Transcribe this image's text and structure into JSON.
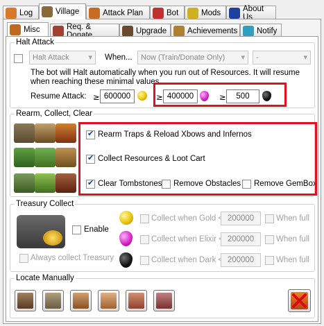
{
  "tabs_top": [
    {
      "label": "Log",
      "icon": "log-icon",
      "color": "#d97a2a"
    },
    {
      "label": "Village",
      "icon": "village-icon",
      "color": "#8a6a3a"
    },
    {
      "label": "Attack Plan",
      "icon": "attack-plan-icon",
      "color": "#c86a20"
    },
    {
      "label": "Bot",
      "icon": "bot-icon",
      "color": "#c03030"
    },
    {
      "label": "Mods",
      "icon": "crown-icon",
      "color": "#d0b020"
    },
    {
      "label": "About Us",
      "icon": "info-icon",
      "color": "#2040a0"
    }
  ],
  "tabs_sub": [
    {
      "label": "Misc",
      "icon": "misc-icon",
      "color": "#c06a20"
    },
    {
      "label": "Req. & Donate",
      "icon": "donate-icon",
      "color": "#a04030"
    },
    {
      "label": "Upgrade",
      "icon": "upgrade-icon",
      "color": "#6a4a2a"
    },
    {
      "label": "Achievements",
      "icon": "achievements-icon",
      "color": "#b08030"
    },
    {
      "label": "Notify",
      "icon": "notify-icon",
      "color": "#30a0c0"
    }
  ],
  "halt": {
    "legend": "Halt Attack",
    "action_value": "Halt Attack",
    "when_label": "When...",
    "when_value": "Now (Train/Donate Only)",
    "extra_value": "-",
    "description": "The bot will Halt automatically when you run out of Resources. It will resume when reaching these minimal values.",
    "resume_label": "Resume Attack:",
    "ge": "≥",
    "gold": "600000",
    "elixir": "400000",
    "dark": "500"
  },
  "rearm": {
    "legend": "Rearm, Collect, Clear",
    "traps": "Rearm Traps & Reload Xbows and Infernos",
    "collect": "Collect Resources & Loot Cart",
    "tombstones": "Clear Tombstones",
    "obstacles": "Remove Obstacles",
    "gembox": "Remove GemBox"
  },
  "treasury": {
    "legend": "Treasury Collect",
    "enable": "Enable",
    "always": "Always collect Treasury",
    "gold_label": "Collect when Gold <",
    "elixir_label": "Collect when Elixir <",
    "dark_label": "Collect when Dark <",
    "gold_value": "200000",
    "elixir_value": "200000",
    "dark_value": "200000",
    "when_full": "When full"
  },
  "locate": {
    "legend": "Locate Manually"
  },
  "colors": {
    "highlight": "#e01020",
    "gold": "#e8c000",
    "elixir": "#d020c0",
    "dark": "#101010"
  }
}
